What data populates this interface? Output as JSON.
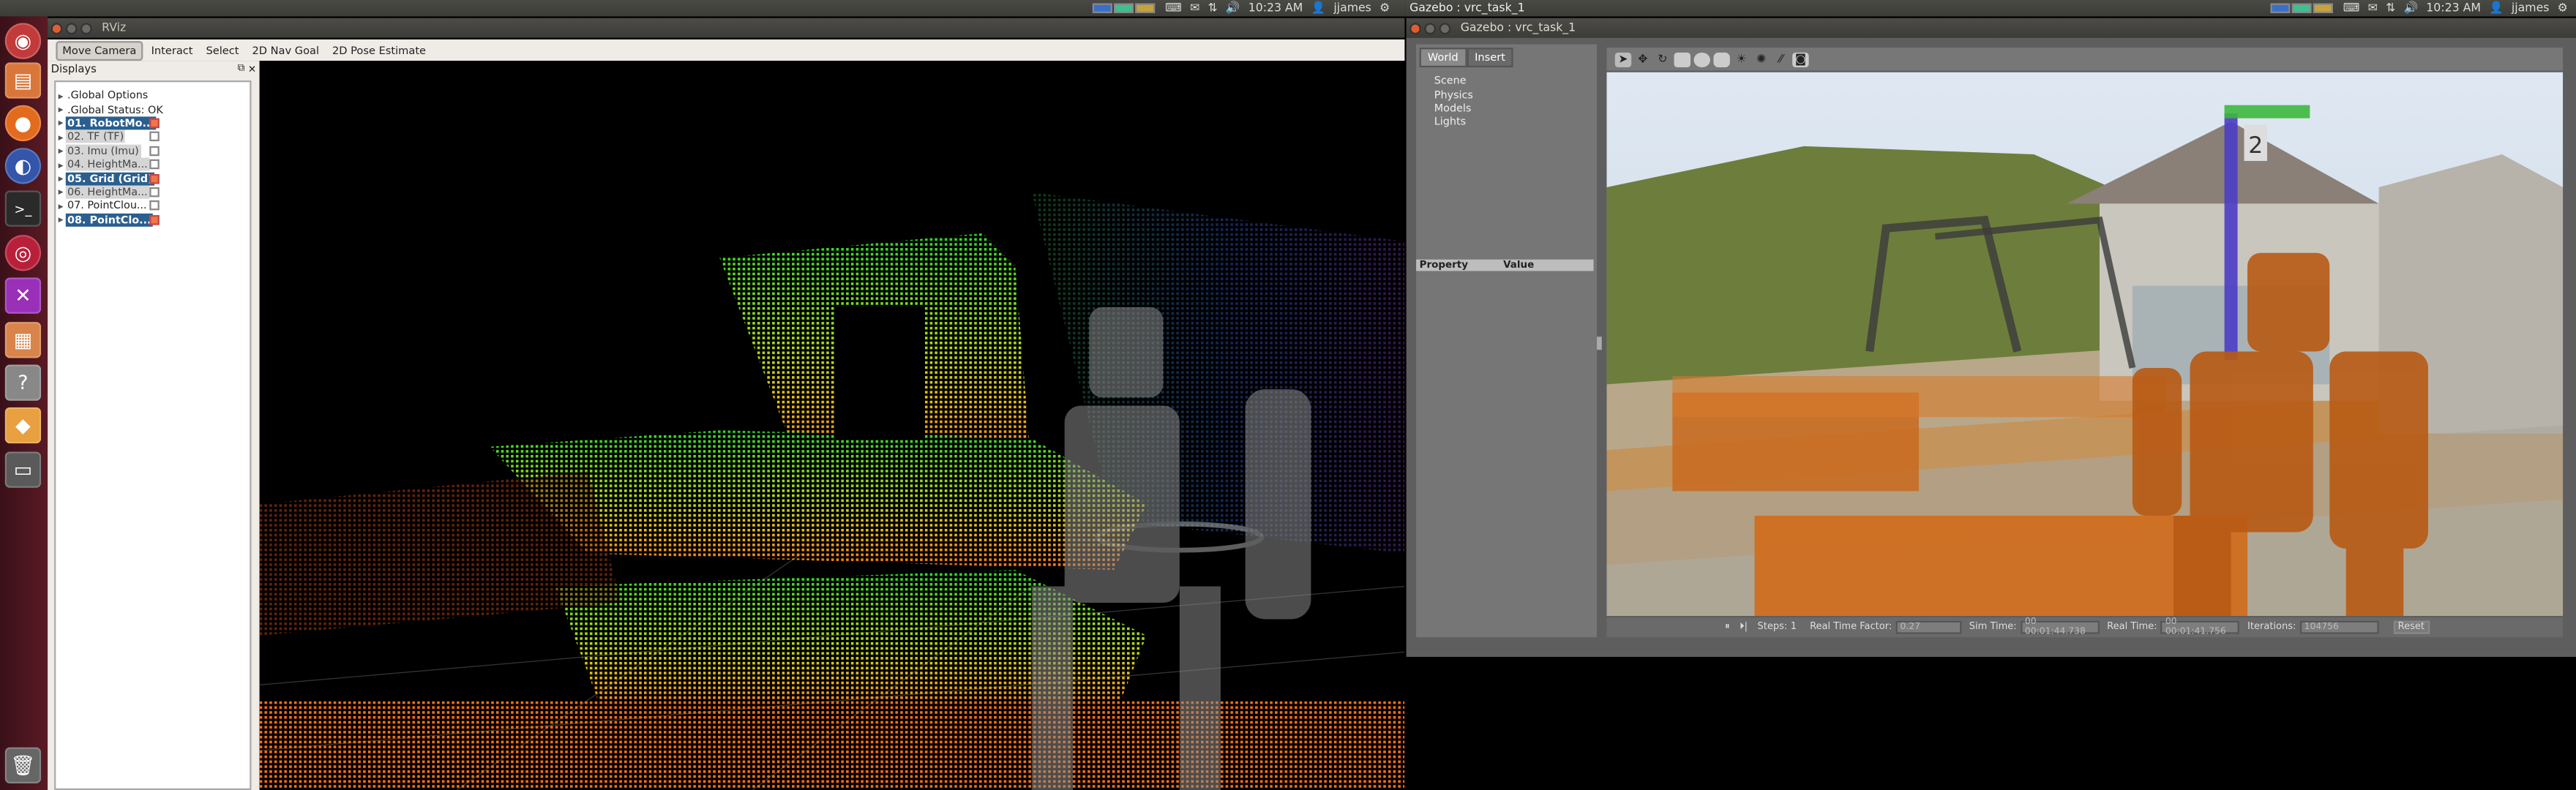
{
  "top_panel_left": {
    "clock": "10:23 AM",
    "user": "jjames"
  },
  "top_panel_right": {
    "clock": "10:23 AM",
    "user": "jjames"
  },
  "rviz": {
    "title": "RViz",
    "toolbar": [
      "Move Camera",
      "Interact",
      "Select",
      "2D Nav Goal",
      "2D Pose Estimate"
    ],
    "displays_panel_title": "Displays",
    "displays": [
      {
        "label": ".Global Options",
        "style": "plain",
        "check": null
      },
      {
        "label": ".Global Status: OK",
        "style": "plain",
        "check": null
      },
      {
        "label": "01. RobotMo...",
        "style": "sel",
        "check": true
      },
      {
        "label": "02. TF (TF)",
        "style": "gray",
        "check": false
      },
      {
        "label": "03. Imu (Imu)",
        "style": "gray",
        "check": false
      },
      {
        "label": "04. HeightMa...",
        "style": "gray",
        "check": false
      },
      {
        "label": "05. Grid (Grid)",
        "style": "sel",
        "check": true
      },
      {
        "label": "06. HeightMa...",
        "style": "gray",
        "check": false
      },
      {
        "label": "07. PointClou...",
        "style": "plain",
        "check": false
      },
      {
        "label": "08. PointClo...",
        "style": "sel",
        "check": true
      }
    ]
  },
  "gazebo": {
    "title": "Gazebo : vrc_task_1",
    "tabs": [
      "World",
      "Insert"
    ],
    "tree": [
      "Scene",
      "Physics",
      "Models",
      "Lights"
    ],
    "property_header": "Property",
    "value_header": "Value",
    "bottom": {
      "steps_label": "Steps:",
      "steps_value": "1",
      "rtf_label": "Real Time Factor:",
      "rtf_value": "0.27",
      "sim_label": "Sim Time:",
      "sim_value": "00 00:01:44.738",
      "real_label": "Real Time:",
      "real_value": "00 00:01:41.756",
      "iter_label": "Iterations:",
      "iter_value": "104756",
      "reset_label": "Reset"
    },
    "scene_sign_number": "2"
  },
  "colors": {
    "accent": "#e9794a",
    "selection": "#2a5f8f",
    "launcher": "#4a1520"
  }
}
